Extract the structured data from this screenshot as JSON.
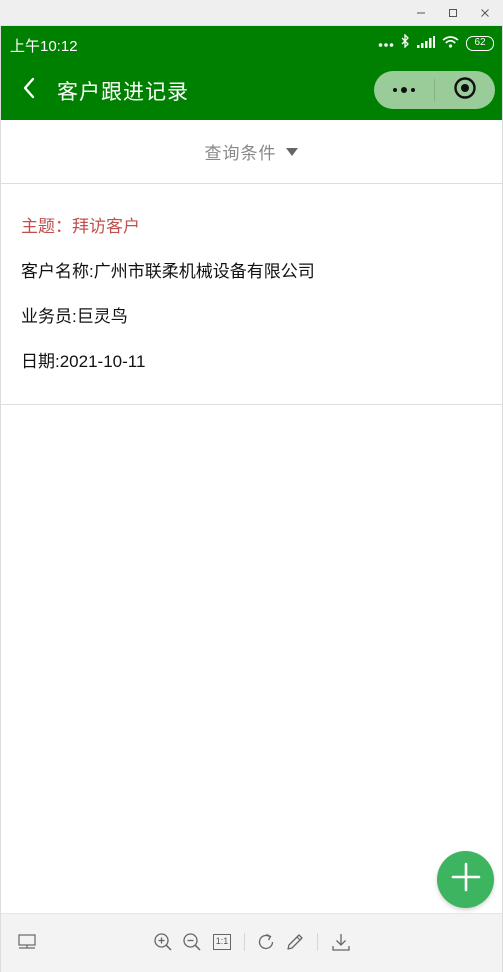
{
  "window": {
    "controls": [
      "minimize-icon",
      "maximize-icon",
      "close-icon"
    ]
  },
  "status_bar": {
    "time": "上午10:12",
    "battery": "62",
    "icons": [
      "dots-icon",
      "bluetooth-icon",
      "signal-icon",
      "wifi-icon",
      "battery-icon"
    ]
  },
  "nav_bar": {
    "title": "客户跟进记录",
    "back_icon": "chevron-left-icon",
    "more_icon": "more-dots-icon",
    "close_icon": "target-circle-icon"
  },
  "filter": {
    "label": "查询条件",
    "arrow_icon": "triangle-down-icon"
  },
  "records": [
    {
      "subject": "主题：拜访客户",
      "customer": "客户名称:广州市联柔机械设备有限公司",
      "salesman": "业务员:巨灵鸟",
      "date": "日期:2021-10-11"
    }
  ],
  "fab": {
    "icon": "plus-icon"
  },
  "toolbar": {
    "icons": [
      "layout-icon",
      "zoom-in-icon",
      "zoom-out-icon",
      "actual-size-icon",
      "rotate-icon",
      "edit-pen-icon",
      "download-icon"
    ],
    "actual_size_label": "1:1"
  },
  "colors": {
    "nav_green": "#008000",
    "subject_red": "#c0504d",
    "fab_green": "#3db560",
    "muted_gray": "#888888"
  }
}
